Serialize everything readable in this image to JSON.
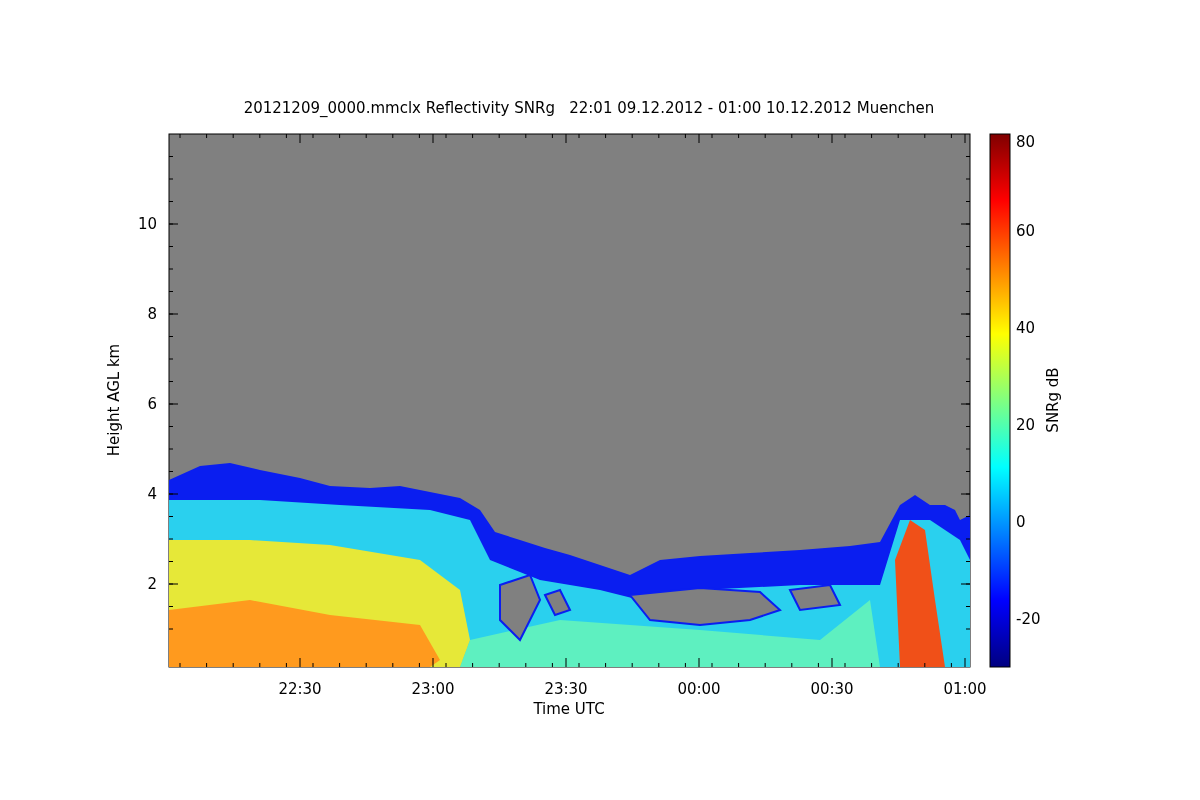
{
  "title": "20121209_0000.mmclx Reflectivity SNRg   22:01 09.12.2012 - 01:00 10.12.2012 Muenchen",
  "plot": {
    "ylabel": "Height AGL km",
    "xlabel": "Time UTC",
    "yticks": [
      "10",
      "8",
      "6",
      "4",
      "2"
    ],
    "xticks": [
      "22:30",
      "23:00",
      "23:30",
      "00:00",
      "00:30",
      "01:00"
    ]
  },
  "colorbar": {
    "label": "SNRg dB",
    "ticks": [
      "80",
      "60",
      "40",
      "20",
      "0",
      "-20"
    ]
  }
}
